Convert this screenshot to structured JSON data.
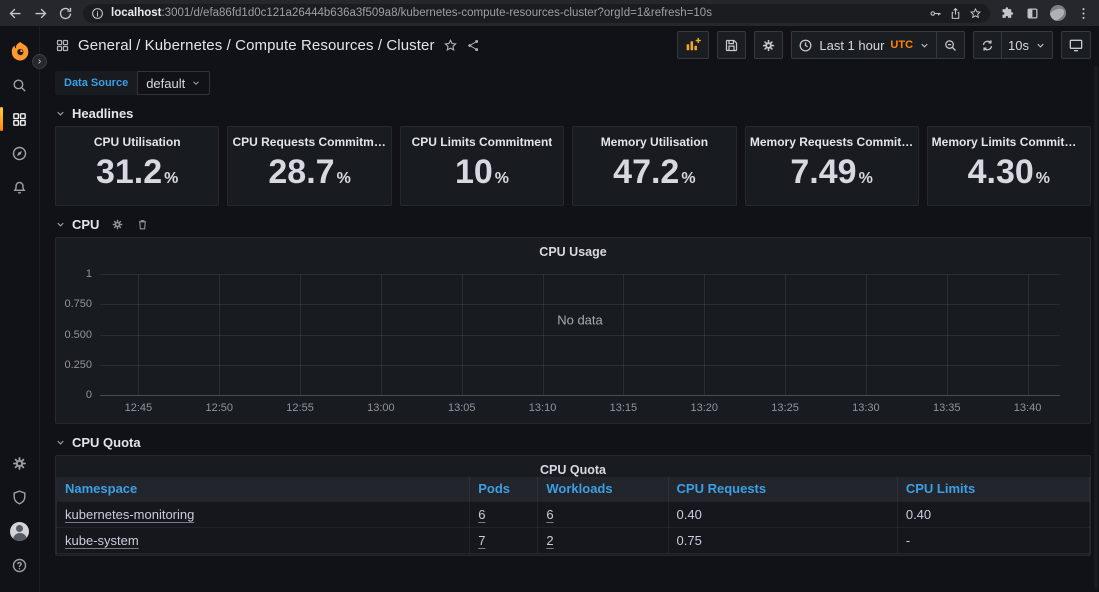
{
  "colors": {
    "accent_orange": "#ff8400",
    "link_blue": "#3ba0e6",
    "logo_orange": "#ff9830"
  },
  "browser": {
    "url_host": "localhost",
    "url_rest": ":3001/d/efa86fd1d0c121a26444b636a3f509a8/kubernetes-compute-resources-cluster?orgId=1&refresh=10s"
  },
  "header": {
    "folder": "General",
    "dashboard_path": "/ Kubernetes / Compute Resources / Cluster",
    "time_range": "Last 1 hour",
    "timezone": "UTC",
    "refresh_interval": "10s"
  },
  "submenu": {
    "datasource_label": "Data Source",
    "datasource_value": "default"
  },
  "sections": {
    "headlines": "Headlines",
    "cpu": "CPU",
    "cpu_quota": "CPU Quota"
  },
  "stats": [
    {
      "label": "CPU Utilisation",
      "value": "31.2",
      "unit": "%"
    },
    {
      "label": "CPU Requests Commitment",
      "value": "28.7",
      "unit": "%"
    },
    {
      "label": "CPU Limits Commitment",
      "value": "10",
      "unit": "%"
    },
    {
      "label": "Memory Utilisation",
      "value": "47.2",
      "unit": "%"
    },
    {
      "label": "Memory Requests Commitm...",
      "value": "7.49",
      "unit": "%"
    },
    {
      "label": "Memory Limits Commitment",
      "value": "4.30",
      "unit": "%"
    }
  ],
  "chart_data": {
    "type": "line",
    "title": "CPU Usage",
    "no_data_text": "No data",
    "series": [],
    "ylim": [
      0,
      1
    ],
    "y_ticks": [
      "1",
      "0.750",
      "0.500",
      "0.250",
      "0"
    ],
    "x_ticks": [
      "12:45",
      "12:50",
      "12:55",
      "13:00",
      "13:05",
      "13:10",
      "13:15",
      "13:20",
      "13:25",
      "13:30",
      "13:35",
      "13:40"
    ],
    "grid": true,
    "legend_position": "none"
  },
  "table": {
    "title": "CPU Quota",
    "columns": [
      "Namespace",
      "Pods",
      "Workloads",
      "CPU Requests",
      "CPU Limits"
    ],
    "column_widths_pct": [
      40,
      6.6,
      12.6,
      22.2,
      18.6
    ],
    "rows": [
      {
        "cells": [
          "kubernetes-monitoring",
          "6",
          "6",
          "0.40",
          "0.40"
        ],
        "link_cols": [
          0,
          1,
          2
        ]
      },
      {
        "cells": [
          "kube-system",
          "7",
          "2",
          "0.75",
          "-"
        ],
        "link_cols": [
          0,
          1,
          2
        ]
      }
    ]
  }
}
